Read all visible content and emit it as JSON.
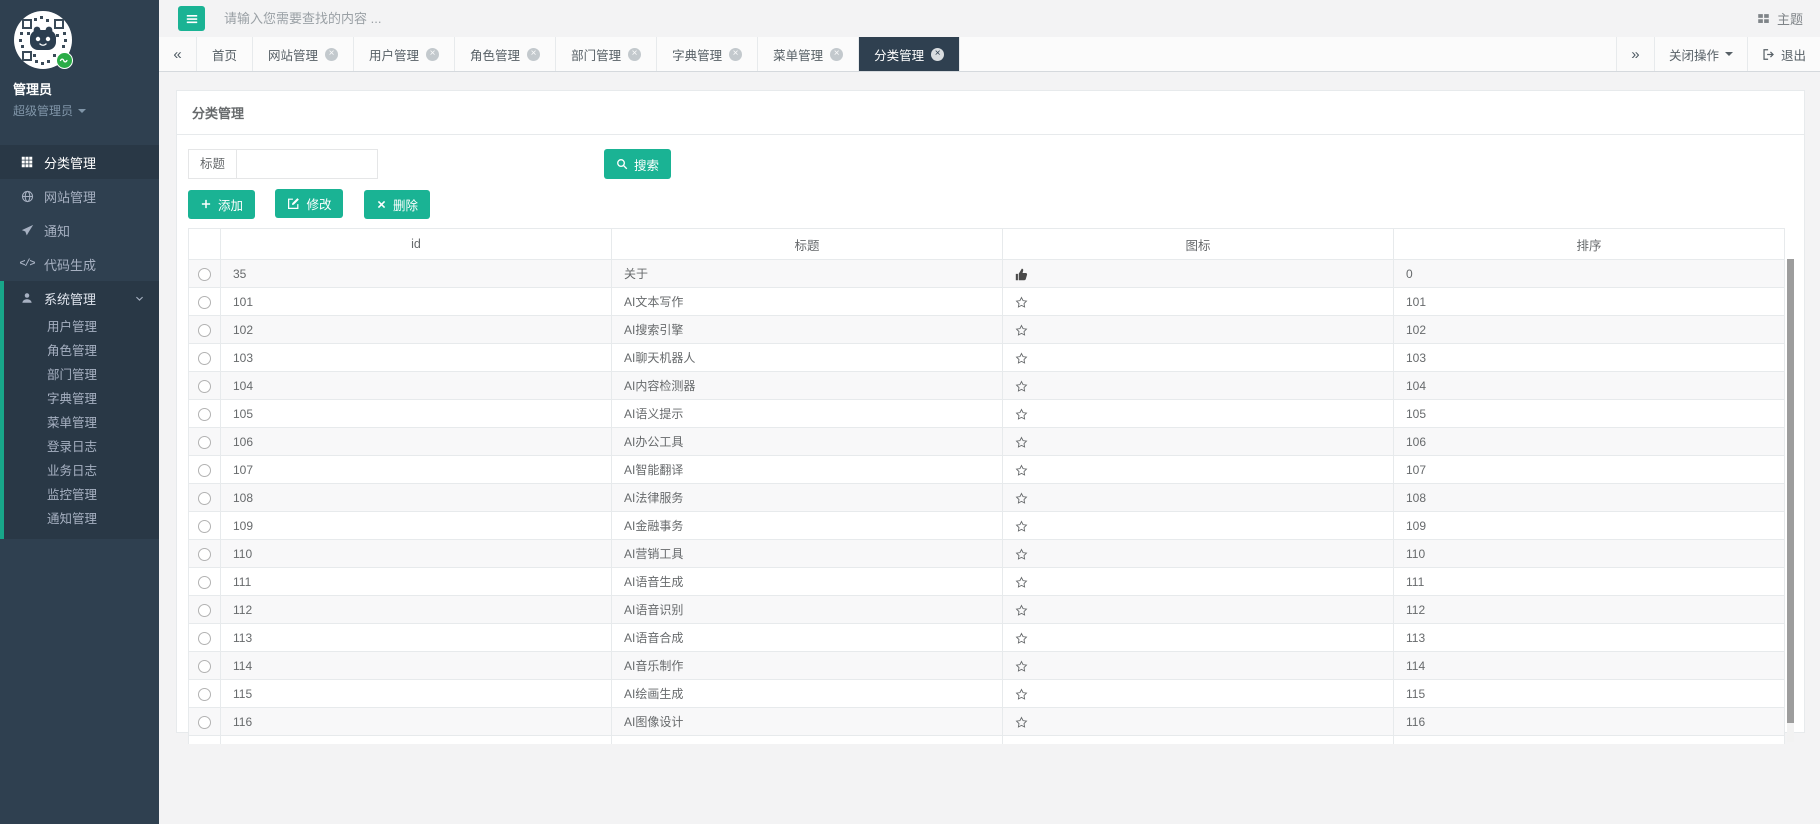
{
  "user": {
    "name": "管理员",
    "role": "超级管理员"
  },
  "topbar": {
    "search_placeholder": "请输入您需要查找的内容 ...",
    "theme_label": "主题"
  },
  "tabbar": {
    "tabs": [
      {
        "label": "首页",
        "closable": false,
        "active": false
      },
      {
        "label": "网站管理",
        "closable": true,
        "active": false
      },
      {
        "label": "用户管理",
        "closable": true,
        "active": false
      },
      {
        "label": "角色管理",
        "closable": true,
        "active": false
      },
      {
        "label": "部门管理",
        "closable": true,
        "active": false
      },
      {
        "label": "字典管理",
        "closable": true,
        "active": false
      },
      {
        "label": "菜单管理",
        "closable": true,
        "active": false
      },
      {
        "label": "分类管理",
        "closable": true,
        "active": true
      }
    ],
    "close_ops_label": "关闭操作",
    "logout_label": "退出"
  },
  "sidebar": {
    "items": [
      {
        "label": "分类管理",
        "icon": "th",
        "active": true
      },
      {
        "label": "网站管理",
        "icon": "globe",
        "active": false
      },
      {
        "label": "通知",
        "icon": "send",
        "active": false
      },
      {
        "label": "代码生成",
        "icon": "code",
        "active": false
      },
      {
        "label": "系统管理",
        "icon": "user",
        "expanded": true,
        "children": [
          "用户管理",
          "角色管理",
          "部门管理",
          "字典管理",
          "菜单管理",
          "登录日志",
          "业务日志",
          "监控管理",
          "通知管理"
        ]
      }
    ]
  },
  "page": {
    "title": "分类管理"
  },
  "filter": {
    "field_label": "标题",
    "field_value": "",
    "search_label": "搜索"
  },
  "actions": {
    "add": "添加",
    "edit": "修改",
    "delete": "删除"
  },
  "table": {
    "columns": [
      "id",
      "标题",
      "图标",
      "排序"
    ],
    "rows": [
      {
        "id": "35",
        "title": "关于",
        "icon": "thumbs-up",
        "sort": "0"
      },
      {
        "id": "101",
        "title": "AI文本写作",
        "icon": "star",
        "sort": "101"
      },
      {
        "id": "102",
        "title": "AI搜索引擎",
        "icon": "star",
        "sort": "102"
      },
      {
        "id": "103",
        "title": "AI聊天机器人",
        "icon": "star",
        "sort": "103"
      },
      {
        "id": "104",
        "title": "AI内容检测器",
        "icon": "star",
        "sort": "104"
      },
      {
        "id": "105",
        "title": "AI语义提示",
        "icon": "star",
        "sort": "105"
      },
      {
        "id": "106",
        "title": "AI办公工具",
        "icon": "star",
        "sort": "106"
      },
      {
        "id": "107",
        "title": "AI智能翻译",
        "icon": "star",
        "sort": "107"
      },
      {
        "id": "108",
        "title": "AI法律服务",
        "icon": "star",
        "sort": "108"
      },
      {
        "id": "109",
        "title": "AI金融事务",
        "icon": "star",
        "sort": "109"
      },
      {
        "id": "110",
        "title": "AI营销工具",
        "icon": "star",
        "sort": "110"
      },
      {
        "id": "111",
        "title": "AI语音生成",
        "icon": "star",
        "sort": "111"
      },
      {
        "id": "112",
        "title": "AI语音识别",
        "icon": "star",
        "sort": "112"
      },
      {
        "id": "113",
        "title": "AI语音合成",
        "icon": "star",
        "sort": "113"
      },
      {
        "id": "114",
        "title": "AI音乐制作",
        "icon": "star",
        "sort": "114"
      },
      {
        "id": "115",
        "title": "AI绘画生成",
        "icon": "star",
        "sort": "115"
      },
      {
        "id": "116",
        "title": "AI图像设计",
        "icon": "star",
        "sort": "116"
      }
    ]
  },
  "colors": {
    "accent": "#1ab394",
    "sidebar": "#2f4050",
    "sidebar_active": "#293846"
  }
}
